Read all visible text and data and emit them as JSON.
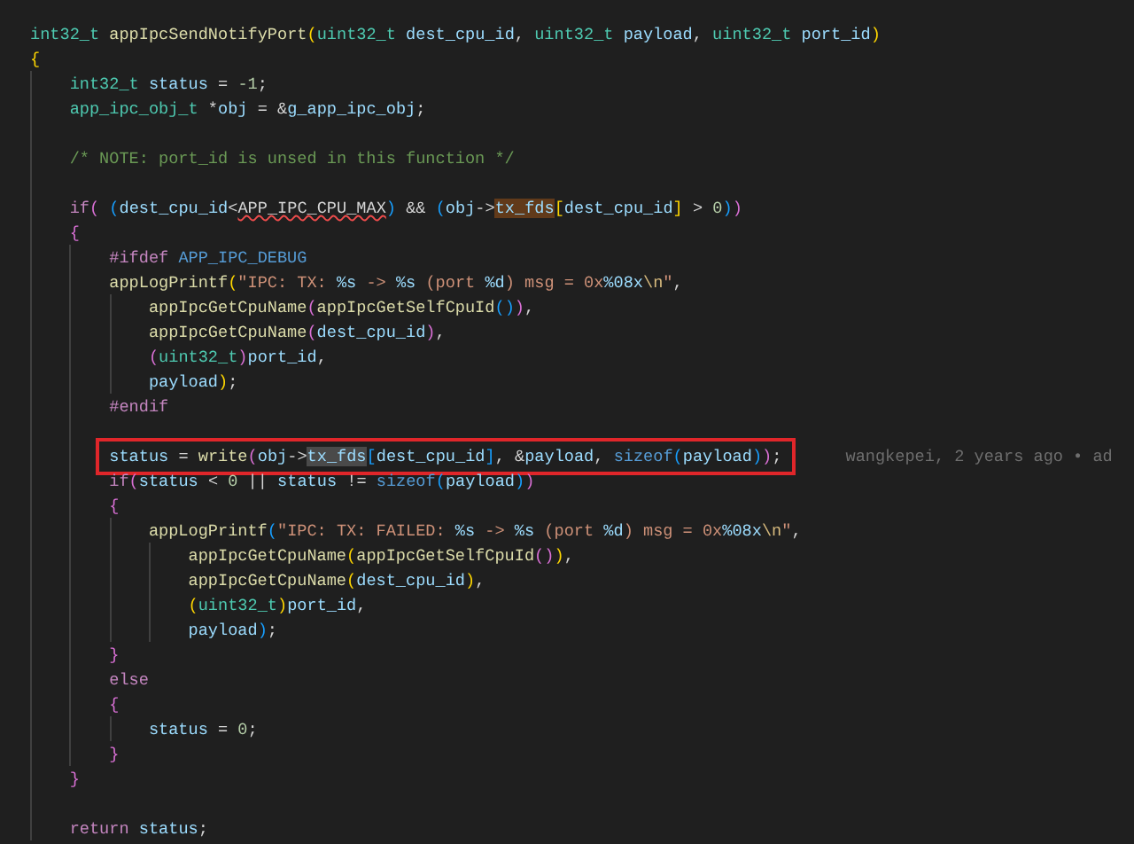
{
  "editor": {
    "lines": [
      {
        "tokens": [
          {
            "text": "int32_t",
            "kind": "type"
          },
          {
            "text": " appIpcSendNotifyPort",
            "kind": "fn"
          },
          {
            "text": "(",
            "kind": "b1"
          },
          {
            "text": "uint32_t",
            "kind": "type"
          },
          {
            "text": " dest_cpu_id",
            "kind": "var"
          },
          {
            "text": ", ",
            "kind": "plain"
          },
          {
            "text": "uint32_t",
            "kind": "type"
          },
          {
            "text": " payload",
            "kind": "var"
          },
          {
            "text": ", ",
            "kind": "plain"
          },
          {
            "text": "uint32_t",
            "kind": "type"
          },
          {
            "text": " port_id",
            "kind": "var"
          },
          {
            "text": ")",
            "kind": "b1"
          }
        ]
      },
      {
        "tokens": [
          {
            "text": "{",
            "kind": "b1"
          }
        ]
      },
      {
        "kind": "code",
        "tokens": [
          {
            "text": "    int32_t",
            "kind": "type"
          },
          {
            "text": " status",
            "kind": "var"
          },
          {
            "text": " = ",
            "kind": "plain"
          },
          {
            "text": "-1",
            "kind": "num"
          },
          {
            "text": ";",
            "kind": "plain"
          }
        ]
      },
      {
        "tokens": [
          {
            "text": "    app_ipc_obj_t",
            "kind": "type"
          },
          {
            "text": " *",
            "kind": "plain"
          },
          {
            "text": "obj",
            "kind": "var"
          },
          {
            "text": " = &",
            "kind": "plain"
          },
          {
            "text": "g_app_ipc_obj",
            "kind": "var"
          },
          {
            "text": ";",
            "kind": "plain"
          }
        ]
      },
      {
        "kind": "blank"
      },
      {
        "tokens": [
          {
            "text": "    /* NOTE: port_id is unsed in this function */",
            "kind": "comment"
          }
        ]
      },
      {
        "kind": "blank"
      },
      {
        "tokens": [
          {
            "text": "    if",
            "kind": "kw"
          },
          {
            "text": "(",
            "kind": "b2"
          },
          {
            "text": " (",
            "kind": "b3"
          },
          {
            "text": "dest_cpu_id",
            "kind": "var"
          },
          {
            "text": "<",
            "kind": "plain"
          },
          {
            "text": "APP_IPC_CPU_MAX",
            "kind": "const",
            "squiggle": true
          },
          {
            "text": ")",
            "kind": "b3"
          },
          {
            "text": " && ",
            "kind": "plain"
          },
          {
            "text": "(",
            "kind": "b3"
          },
          {
            "text": "obj",
            "kind": "var"
          },
          {
            "text": "->",
            "kind": "plain"
          },
          {
            "text": "tx_fds",
            "kind": "var",
            "find_match": true
          },
          {
            "text": "[",
            "kind": "b1"
          },
          {
            "text": "dest_cpu_id",
            "kind": "var"
          },
          {
            "text": "]",
            "kind": "b1"
          },
          {
            "text": " > ",
            "kind": "plain"
          },
          {
            "text": "0",
            "kind": "num"
          },
          {
            "text": ")",
            "kind": "b3"
          },
          {
            "text": ")",
            "kind": "b2"
          }
        ]
      },
      {
        "tokens": [
          {
            "text": "    {",
            "kind": "b2"
          }
        ]
      },
      {
        "tokens": [
          {
            "text": "        #ifdef",
            "kind": "kw"
          },
          {
            "text": " APP_IPC_DEBUG",
            "kind": "macro"
          }
        ]
      },
      {
        "tokens": [
          {
            "text": "        appLogPrintf",
            "kind": "fn"
          },
          {
            "text": "(",
            "kind": "b1"
          },
          {
            "text": "\"IPC: TX: ",
            "kind": "str"
          },
          {
            "text": "%s",
            "kind": "fmt"
          },
          {
            "text": " -> ",
            "kind": "str"
          },
          {
            "text": "%s",
            "kind": "fmt"
          },
          {
            "text": " (port ",
            "kind": "str"
          },
          {
            "text": "%d",
            "kind": "fmt"
          },
          {
            "text": ") msg = 0x",
            "kind": "str"
          },
          {
            "text": "%08x",
            "kind": "fmt"
          },
          {
            "text": "\\n",
            "kind": "esc"
          },
          {
            "text": "\"",
            "kind": "str"
          },
          {
            "text": ",",
            "kind": "plain"
          }
        ]
      },
      {
        "tokens": [
          {
            "text": "            appIpcGetCpuName",
            "kind": "fn"
          },
          {
            "text": "(",
            "kind": "b2"
          },
          {
            "text": "appIpcGetSelfCpuId",
            "kind": "fn"
          },
          {
            "text": "()",
            "kind": "b3"
          },
          {
            "text": ")",
            "kind": "b2"
          },
          {
            "text": ",",
            "kind": "plain"
          }
        ]
      },
      {
        "tokens": [
          {
            "text": "            appIpcGetCpuName",
            "kind": "fn"
          },
          {
            "text": "(",
            "kind": "b2"
          },
          {
            "text": "dest_cpu_id",
            "kind": "var"
          },
          {
            "text": ")",
            "kind": "b2"
          },
          {
            "text": ",",
            "kind": "plain"
          }
        ]
      },
      {
        "tokens": [
          {
            "text": "            (",
            "kind": "b2"
          },
          {
            "text": "uint32_t",
            "kind": "type"
          },
          {
            "text": ")",
            "kind": "b2"
          },
          {
            "text": "port_id",
            "kind": "var"
          },
          {
            "text": ",",
            "kind": "plain"
          }
        ]
      },
      {
        "tokens": [
          {
            "text": "            payload",
            "kind": "var"
          },
          {
            "text": ")",
            "kind": "b1"
          },
          {
            "text": ";",
            "kind": "plain"
          }
        ]
      },
      {
        "tokens": [
          {
            "text": "        #endif",
            "kind": "kw"
          }
        ]
      },
      {
        "kind": "blank"
      },
      {
        "boxed": true,
        "blame": "wangkepei, 2 years ago • ad",
        "tokens": [
          {
            "text": "        status",
            "kind": "var"
          },
          {
            "text": " = ",
            "kind": "plain"
          },
          {
            "text": "write",
            "kind": "fn"
          },
          {
            "text": "(",
            "kind": "b2"
          },
          {
            "text": "obj",
            "kind": "var"
          },
          {
            "text": "->",
            "kind": "plain"
          },
          {
            "text": "tx_fds",
            "kind": "var",
            "selected": true
          },
          {
            "text": "[",
            "kind": "b3"
          },
          {
            "text": "dest_cpu_id",
            "kind": "var"
          },
          {
            "text": "]",
            "kind": "b3"
          },
          {
            "text": ", &",
            "kind": "plain"
          },
          {
            "text": "payload",
            "kind": "var"
          },
          {
            "text": ", ",
            "kind": "plain"
          },
          {
            "text": "sizeof",
            "kind": "macro"
          },
          {
            "text": "(",
            "kind": "b3"
          },
          {
            "text": "payload",
            "kind": "var"
          },
          {
            "text": ")",
            "kind": "b3"
          },
          {
            "text": ")",
            "kind": "b2"
          },
          {
            "text": ";",
            "kind": "plain"
          }
        ]
      },
      {
        "tokens": [
          {
            "text": "        if",
            "kind": "kw"
          },
          {
            "text": "(",
            "kind": "b2"
          },
          {
            "text": "status",
            "kind": "var"
          },
          {
            "text": " < ",
            "kind": "plain"
          },
          {
            "text": "0",
            "kind": "num"
          },
          {
            "text": " || ",
            "kind": "plain"
          },
          {
            "text": "status",
            "kind": "var"
          },
          {
            "text": " != ",
            "kind": "plain"
          },
          {
            "text": "sizeof",
            "kind": "macro"
          },
          {
            "text": "(",
            "kind": "b3"
          },
          {
            "text": "payload",
            "kind": "var"
          },
          {
            "text": ")",
            "kind": "b3"
          },
          {
            "text": ")",
            "kind": "b2"
          }
        ]
      },
      {
        "tokens": [
          {
            "text": "        {",
            "kind": "b2"
          }
        ]
      },
      {
        "tokens": [
          {
            "text": "            appLogPrintf",
            "kind": "fn"
          },
          {
            "text": "(",
            "kind": "b3"
          },
          {
            "text": "\"IPC: TX: FAILED: ",
            "kind": "str"
          },
          {
            "text": "%s",
            "kind": "fmt"
          },
          {
            "text": " -> ",
            "kind": "str"
          },
          {
            "text": "%s",
            "kind": "fmt"
          },
          {
            "text": " (port ",
            "kind": "str"
          },
          {
            "text": "%d",
            "kind": "fmt"
          },
          {
            "text": ") msg = 0x",
            "kind": "str"
          },
          {
            "text": "%08x",
            "kind": "fmt"
          },
          {
            "text": "\\n",
            "kind": "esc"
          },
          {
            "text": "\"",
            "kind": "str"
          },
          {
            "text": ",",
            "kind": "plain"
          }
        ]
      },
      {
        "tokens": [
          {
            "text": "                appIpcGetCpuName",
            "kind": "fn"
          },
          {
            "text": "(",
            "kind": "b1"
          },
          {
            "text": "appIpcGetSelfCpuId",
            "kind": "fn"
          },
          {
            "text": "()",
            "kind": "b2"
          },
          {
            "text": ")",
            "kind": "b1"
          },
          {
            "text": ",",
            "kind": "plain"
          }
        ]
      },
      {
        "tokens": [
          {
            "text": "                appIpcGetCpuName",
            "kind": "fn"
          },
          {
            "text": "(",
            "kind": "b1"
          },
          {
            "text": "dest_cpu_id",
            "kind": "var"
          },
          {
            "text": ")",
            "kind": "b1"
          },
          {
            "text": ",",
            "kind": "plain"
          }
        ]
      },
      {
        "tokens": [
          {
            "text": "                (",
            "kind": "b1"
          },
          {
            "text": "uint32_t",
            "kind": "type"
          },
          {
            "text": ")",
            "kind": "b1"
          },
          {
            "text": "port_id",
            "kind": "var"
          },
          {
            "text": ",",
            "kind": "plain"
          }
        ]
      },
      {
        "tokens": [
          {
            "text": "                payload",
            "kind": "var"
          },
          {
            "text": ")",
            "kind": "b3"
          },
          {
            "text": ";",
            "kind": "plain"
          }
        ]
      },
      {
        "tokens": [
          {
            "text": "        }",
            "kind": "b2"
          }
        ]
      },
      {
        "tokens": [
          {
            "text": "        else",
            "kind": "kw"
          }
        ]
      },
      {
        "tokens": [
          {
            "text": "        {",
            "kind": "b2"
          }
        ]
      },
      {
        "tokens": [
          {
            "text": "            status",
            "kind": "var"
          },
          {
            "text": " = ",
            "kind": "plain"
          },
          {
            "text": "0",
            "kind": "num"
          },
          {
            "text": ";",
            "kind": "plain"
          }
        ]
      },
      {
        "tokens": [
          {
            "text": "        }",
            "kind": "b2"
          }
        ]
      },
      {
        "tokens": [
          {
            "text": "    }",
            "kind": "b2"
          }
        ]
      },
      {
        "kind": "blank"
      },
      {
        "tokens": [
          {
            "text": "    return",
            "kind": "kw"
          },
          {
            "text": " status",
            "kind": "var"
          },
          {
            "text": ";",
            "kind": "plain"
          }
        ]
      }
    ]
  }
}
